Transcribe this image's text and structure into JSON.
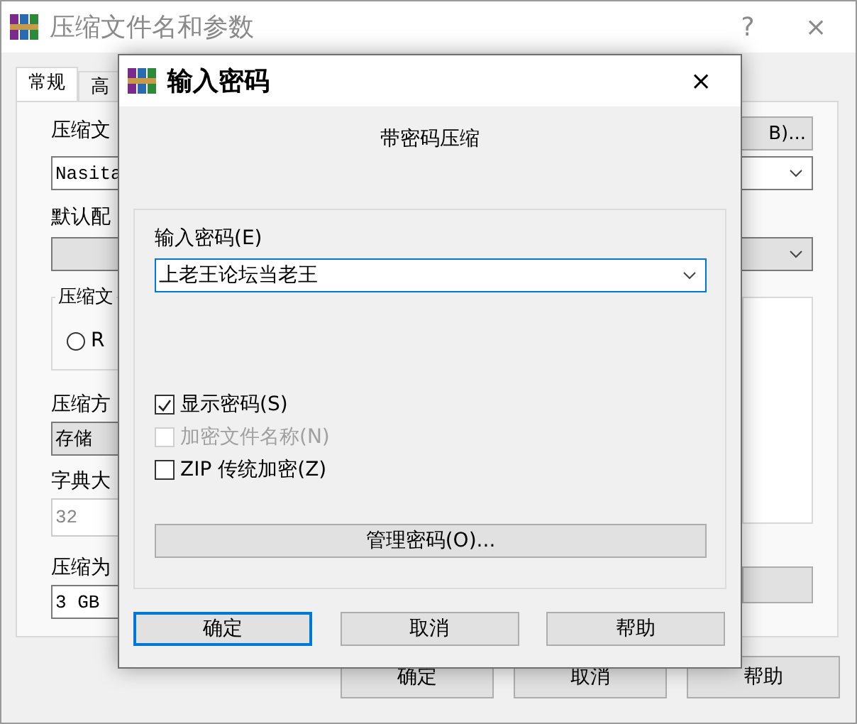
{
  "window": {
    "title": "压缩文件名和参数",
    "help_button": "?",
    "close_button": "×"
  },
  "tabs": [
    {
      "label": "常规",
      "selected": true
    },
    {
      "label": "高",
      "selected": false
    }
  ],
  "general": {
    "archive_label": "压缩文",
    "browse_button": "B)...",
    "archive_name": "Nasita",
    "profile_label": "默认配",
    "format_group": "压缩文",
    "format_options": [
      {
        "label": "R",
        "selected": false
      }
    ],
    "method_label": "压缩方",
    "method": "存储",
    "dictionary_label": "字典大",
    "dictionary": "32",
    "split_label": "压缩为",
    "split": "3 GB"
  },
  "buttons": [
    {
      "label": "确定"
    },
    {
      "label": "取消"
    },
    {
      "label": "帮助"
    }
  ],
  "dialog": {
    "title": "输入密码",
    "close_button": "×",
    "heading": "带密码压缩",
    "password_label": "输入密码(E)",
    "password": "上老王论坛当老王",
    "options": [
      {
        "label": "显示密码(S)",
        "checked": true,
        "disabled": false
      },
      {
        "label": "加密文件名称(N)",
        "checked": false,
        "disabled": true
      },
      {
        "label": "ZIP 传统加密(Z)",
        "checked": false,
        "disabled": false
      }
    ],
    "manage_button": "管理密码(O)...",
    "buttons": [
      {
        "label": "确定",
        "default": true
      },
      {
        "label": "取消",
        "default": false
      },
      {
        "label": "帮助",
        "default": false
      }
    ]
  }
}
